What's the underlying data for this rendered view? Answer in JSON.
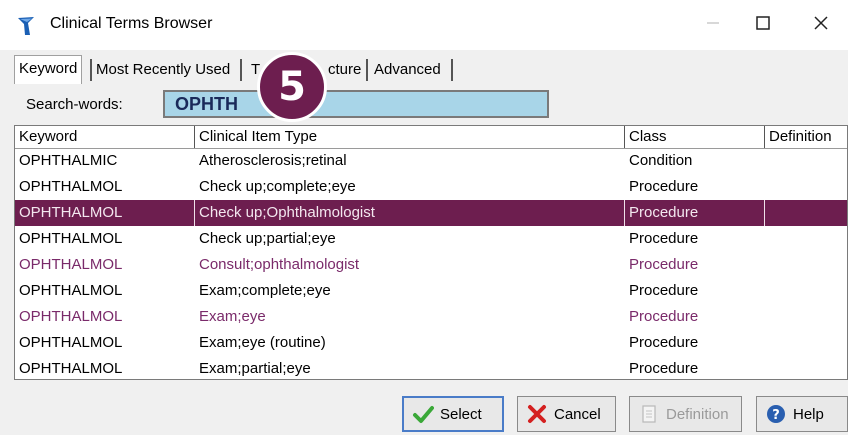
{
  "window": {
    "title": "Clinical Terms Browser",
    "icon": "app-logo-icon",
    "controls": [
      "minimize-icon",
      "maximize-icon",
      "close-icon"
    ]
  },
  "tabs": [
    {
      "label": "Keyword",
      "active": true
    },
    {
      "label": "Most Recently Used",
      "active": false
    },
    {
      "label": "T",
      "active": false
    },
    {
      "label": "cture",
      "active": false
    },
    {
      "label": "Advanced",
      "active": false
    }
  ],
  "step_badge": "5",
  "search": {
    "label": "Search-words:",
    "value": "OPHTH"
  },
  "grid": {
    "columns": [
      "Keyword",
      "Clinical Item Type",
      "Class",
      "Definition"
    ],
    "rows": [
      {
        "keyword": "OPHTHALMIC",
        "type": "Atherosclerosis;retinal",
        "class": "Condition",
        "definition": "",
        "state": "normal"
      },
      {
        "keyword": "OPHTHALMOL",
        "type": "Check up;complete;eye",
        "class": "Procedure",
        "definition": "",
        "state": "normal"
      },
      {
        "keyword": "OPHTHALMOL",
        "type": "Check up;Ophthalmologist",
        "class": "Procedure",
        "definition": "",
        "state": "selected"
      },
      {
        "keyword": "OPHTHALMOL",
        "type": "Check up;partial;eye",
        "class": "Procedure",
        "definition": "",
        "state": "normal"
      },
      {
        "keyword": "OPHTHALMOL",
        "type": "Consult;ophthalmologist",
        "class": "Procedure",
        "definition": "",
        "state": "visited"
      },
      {
        "keyword": "OPHTHALMOL",
        "type": "Exam;complete;eye",
        "class": "Procedure",
        "definition": "",
        "state": "normal"
      },
      {
        "keyword": "OPHTHALMOL",
        "type": "Exam;eye",
        "class": "Procedure",
        "definition": "",
        "state": "visited"
      },
      {
        "keyword": "OPHTHALMOL",
        "type": "Exam;eye (routine)",
        "class": "Procedure",
        "definition": "",
        "state": "normal"
      },
      {
        "keyword": "OPHTHALMOL",
        "type": "Exam;partial;eye",
        "class": "Procedure",
        "definition": "",
        "state": "normal"
      }
    ]
  },
  "buttons": {
    "select": "Select",
    "cancel": "Cancel",
    "definition": "Definition",
    "help": "Help"
  },
  "colors": {
    "selection": "#6d1e4f",
    "visited_text": "#7a2a6a",
    "search_bg": "#a8d5e8",
    "badge": "#6d1e4f"
  }
}
